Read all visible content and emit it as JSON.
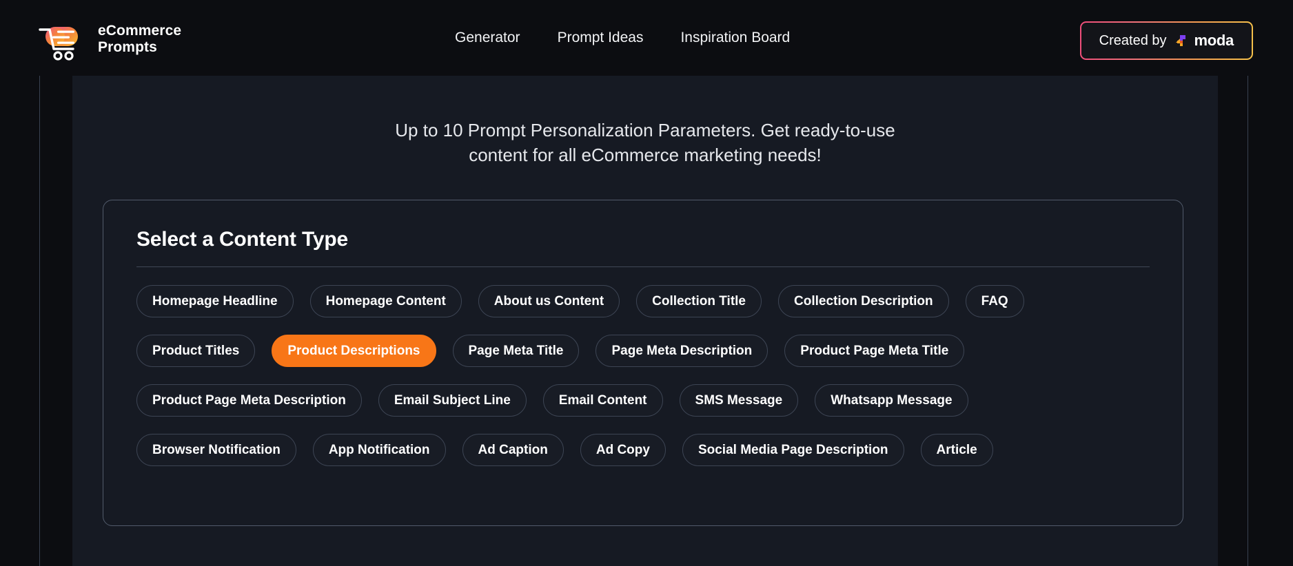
{
  "brand": {
    "line1": "eCommerce",
    "line2": "Prompts",
    "logo_icon": "shopping-cart-icon"
  },
  "nav": {
    "items": [
      {
        "label": "Generator"
      },
      {
        "label": "Prompt Ideas"
      },
      {
        "label": "Inspiration Board"
      }
    ]
  },
  "created_by": {
    "label": "Created by",
    "brand": "moda",
    "icon": "moda-logo-icon",
    "border_gradient_from": "#ef4d7a",
    "border_gradient_to": "#f6c24a"
  },
  "main": {
    "subtitle_line1": "Up to 10 Prompt Personalization Parameters. Get ready-to-use",
    "subtitle_line2": "content for all eCommerce marketing needs!"
  },
  "content_type_card": {
    "title": "Select a Content Type",
    "selected": "Product Descriptions",
    "selected_color": "#f87617",
    "rows": [
      [
        "Homepage Headline",
        "Homepage Content",
        "About us Content",
        "Collection Title",
        "Collection Description",
        "FAQ"
      ],
      [
        "Product Titles",
        "Product Descriptions",
        "Page Meta Title",
        "Page Meta Description",
        "Product Page Meta Title"
      ],
      [
        "Product Page Meta Description",
        "Email Subject Line",
        "Email Content",
        "SMS Message",
        "Whatsapp Message"
      ],
      [
        "Browser Notification",
        "App Notification",
        "Ad Caption",
        "Ad Copy",
        "Social Media Page Description",
        "Article"
      ]
    ]
  }
}
